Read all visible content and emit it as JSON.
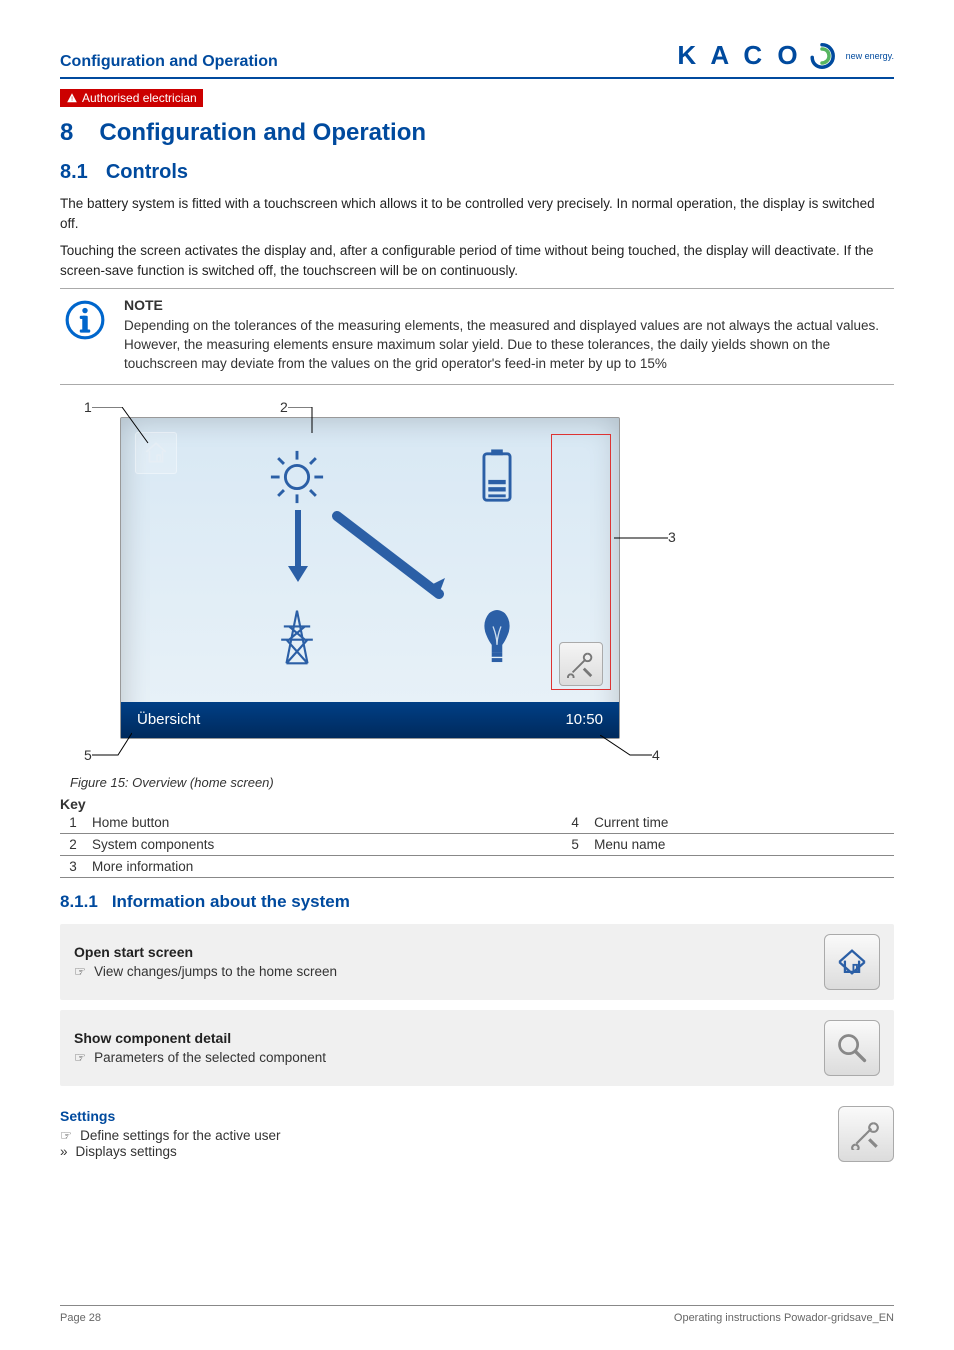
{
  "header": {
    "section_title": "Configuration and Operation"
  },
  "logo": {
    "text": "K A C O",
    "tagline": "new energy."
  },
  "badge": {
    "label": "Authorised electrician"
  },
  "h1": {
    "num": "8",
    "title": "Configuration and Operation"
  },
  "h2": {
    "num": "8.1",
    "title": "Controls"
  },
  "intro": {
    "p1": "The battery system is fitted with a touchscreen which allows it to be controlled very precisely. In normal operation, the display is switched off.",
    "p2": "Touching the screen activates the display and, after a configurable period of time without being touched, the display will deactivate. If the screen-save function is switched off, the touchscreen will be on continuously."
  },
  "note": {
    "title": "NOTE",
    "text": "Depending on the tolerances of the measuring elements, the measured and displayed values are not always the actual values. However, the measuring elements ensure maximum solar yield. Due to these tolerances, the daily yields shown on the touchscreen may deviate from the values on the grid operator's feed-in meter by up to 15%"
  },
  "figure": {
    "footer_menu": "Übersicht",
    "footer_time": "10:50",
    "caption": "Figure 15: Overview (home screen)",
    "callouts": {
      "c1": "1",
      "c2": "2",
      "c3": "3",
      "c4": "4",
      "c5": "5"
    }
  },
  "key": {
    "title": "Key",
    "rows": [
      {
        "n": "1",
        "label": "Home button"
      },
      {
        "n": "2",
        "label": "System components"
      },
      {
        "n": "3",
        "label": "More information"
      },
      {
        "n": "4",
        "label": "Current time"
      },
      {
        "n": "5",
        "label": "Menu name"
      }
    ]
  },
  "h3": {
    "num": "8.1.1",
    "title": "Information about the system"
  },
  "cards": {
    "start": {
      "title": "Open start screen",
      "line": "View changes/jumps to the home screen"
    },
    "detail": {
      "title": "Show component detail",
      "line": "Parameters of the selected component"
    },
    "settings": {
      "title": "Settings",
      "line1": "Define settings for the active user",
      "line2": "Displays settings"
    }
  },
  "footer": {
    "left": "Page 28",
    "right": "Operating instructions Powador-gridsave_EN"
  },
  "glyphs": {
    "hand": "☞",
    "raquo": "»"
  }
}
